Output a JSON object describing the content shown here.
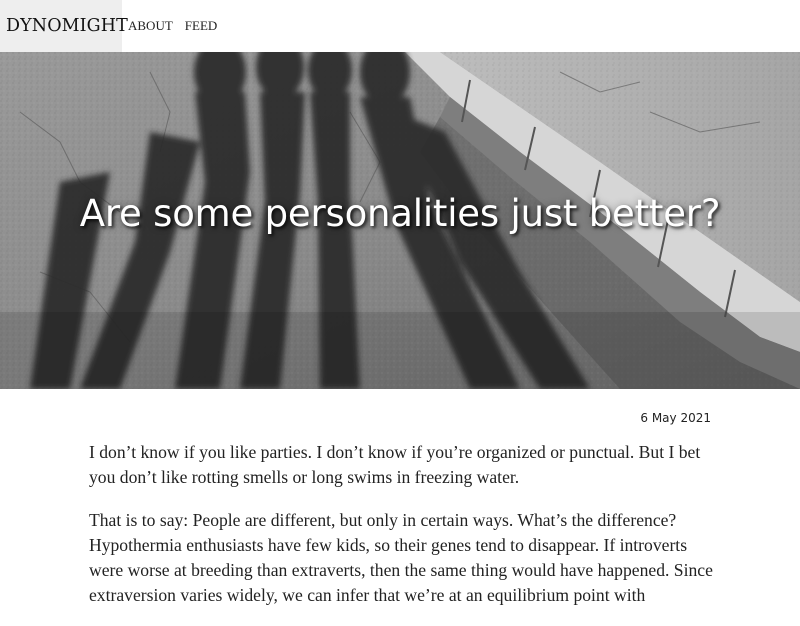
{
  "nav": {
    "brand": "DYNOMIGHT",
    "links": [
      {
        "label": "ABOUT"
      },
      {
        "label": "FEED"
      }
    ]
  },
  "hero": {
    "title": "Are some personalities just better?"
  },
  "article": {
    "date": "6 May 2021",
    "paragraphs": [
      "I don’t know if you like parties. I don’t know if you’re organized or punctual. But I bet you don’t like rotting smells or long swims in freezing water.",
      "That is to say: People are different, but only in certain ways. What’s the difference? Hypothermia enthusiasts have few kids, so their genes tend to disappear. If introverts were worse at breeding than extraverts, then the same thing would have happened. Since extraversion varies widely, we can infer that we’re at an equilibrium point with"
    ]
  }
}
